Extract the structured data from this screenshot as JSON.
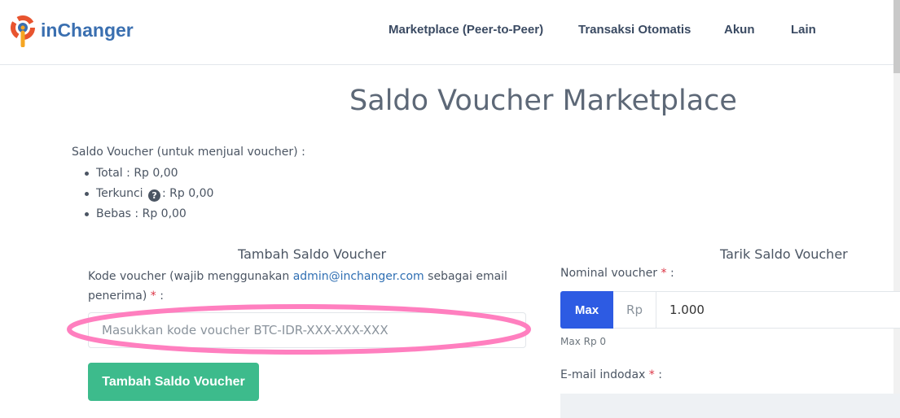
{
  "brand": {
    "name": "inChanger"
  },
  "nav": {
    "items": [
      {
        "label": "Marketplace (Peer-to-Peer)"
      },
      {
        "label": "Transaksi Otomatis"
      },
      {
        "label": "Akun"
      },
      {
        "label": "Lain"
      }
    ]
  },
  "page": {
    "title": "Saldo Voucher Marketplace"
  },
  "saldo": {
    "heading": "Saldo Voucher (untuk menjual voucher) :",
    "total": "Total : Rp 0,00",
    "terkunci_label": "Terkunci",
    "terkunci_value": ": Rp 0,00",
    "bebas": "Bebas : Rp 0,00"
  },
  "tambah": {
    "title": "Tambah Saldo Voucher",
    "label_prefix": "Kode voucher (wajib menggunakan",
    "email_link": "admin@inchanger.com",
    "label_suffix": "sebagai email penerima)",
    "required_mark": "*",
    "label_colon": ":",
    "placeholder": "Masukkan kode voucher BTC-IDR-XXX-XXX-XXX",
    "button": "Tambah Saldo Voucher"
  },
  "tarik": {
    "title": "Tarik Saldo Voucher",
    "nominal_label": "Nominal voucher",
    "required_mark": "*",
    "label_colon": ":",
    "max_button": "Max",
    "currency": "Rp",
    "nominal_value": "1.000",
    "max_note": "Max Rp 0",
    "email_label": "E-mail indodax"
  },
  "colors": {
    "primary": "#2d5be3",
    "success": "#3dbb8c",
    "annotation": "#ff7fbf",
    "required": "#dc3545"
  }
}
